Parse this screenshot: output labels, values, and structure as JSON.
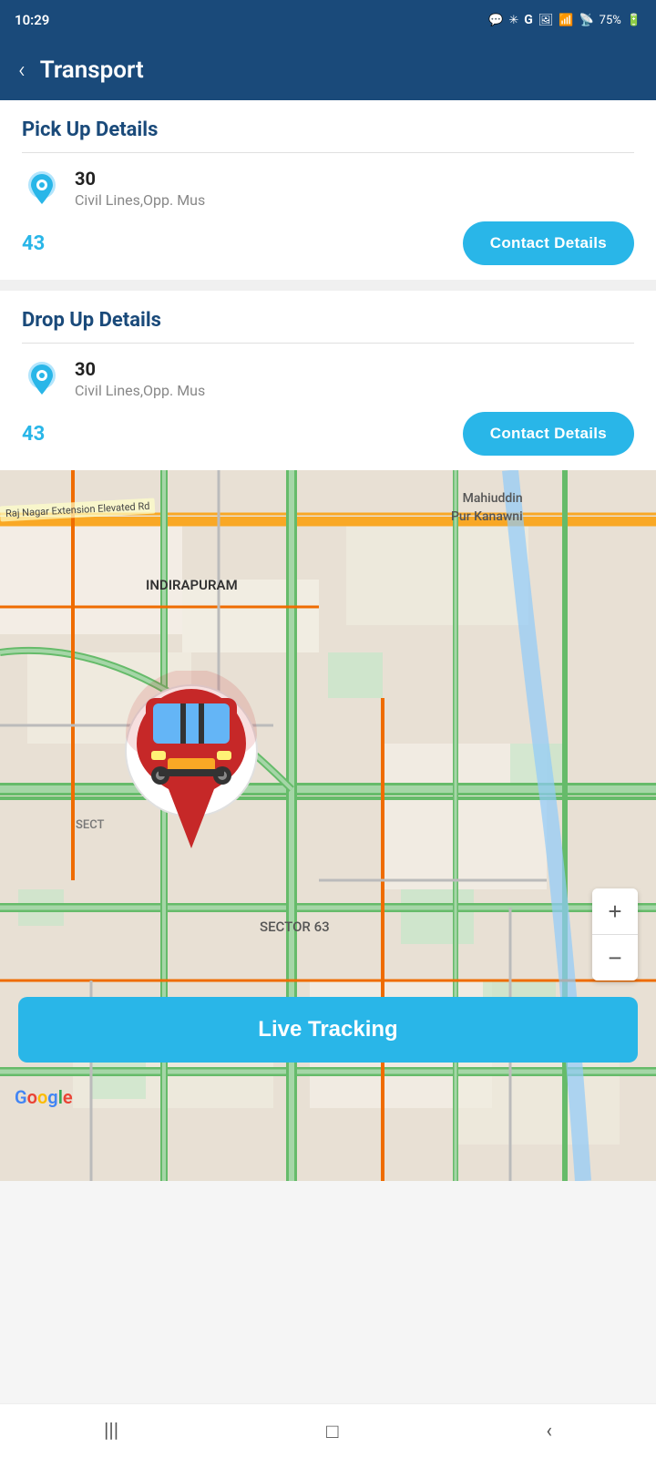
{
  "statusBar": {
    "time": "10:29",
    "battery": "75%",
    "icons": [
      "msg",
      "bluetooth",
      "G",
      "photos",
      "wifi",
      "signal",
      "battery"
    ]
  },
  "header": {
    "title": "Transport",
    "backLabel": "‹"
  },
  "pickupSection": {
    "title": "Pick Up Details",
    "locationNumber": "30",
    "address": "Civil Lines,Opp. Mus",
    "routeNumber": "43",
    "contactButtonLabel": "Contact Details"
  },
  "dropSection": {
    "title": "Drop Up Details",
    "locationNumber": "30",
    "address": "Civil Lines,Opp. Mus",
    "routeNumber": "43",
    "contactButtonLabel": "Contact Details"
  },
  "map": {
    "liveTrackingLabel": "Live Tracking",
    "zoomIn": "+",
    "zoomOut": "−",
    "googleLogo": "Google",
    "labels": [
      {
        "text": "INDIRAPURAM",
        "top": "120",
        "left": "160"
      },
      {
        "text": "SECTOR 63",
        "top": "490",
        "left": "290"
      },
      {
        "text": "Mahiuddin\nPur Kanawni",
        "top": "20",
        "left": "520"
      },
      {
        "text": "SECT",
        "top": "385",
        "left": "85"
      }
    ]
  },
  "navBar": {
    "icons": [
      "|||",
      "□",
      "‹"
    ]
  }
}
